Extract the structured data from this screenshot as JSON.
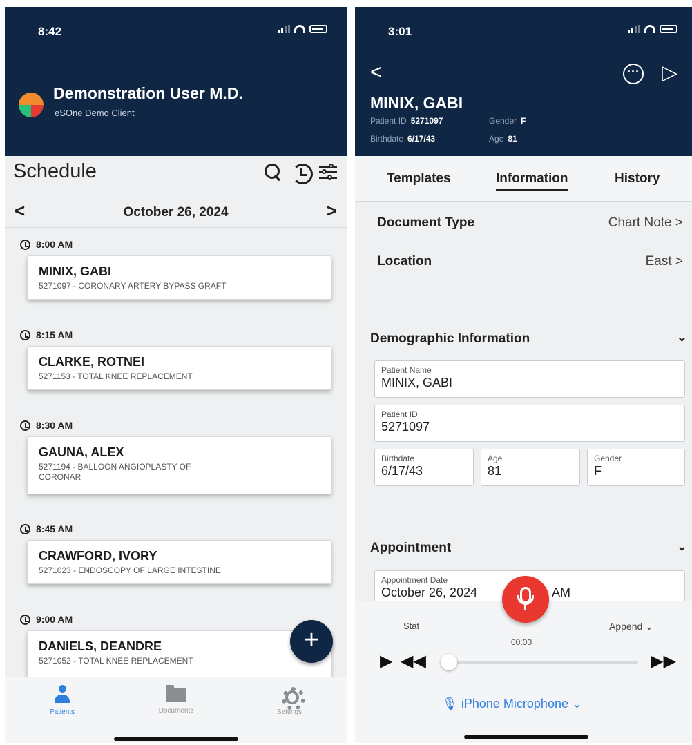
{
  "left": {
    "status_time": "8:42",
    "user_name": "Demonstration User M.D.",
    "client": "eSOne Demo Client",
    "schedule_title": "Schedule",
    "date": "October 26, 2024",
    "appointments": [
      {
        "time": "8:00 AM",
        "name": "MINIX, GABI",
        "proc": "5271097 - CORONARY ARTERY BYPASS GRAFT"
      },
      {
        "time": "8:15 AM",
        "name": "CLARKE, ROTNEI",
        "proc": "5271153 - TOTAL KNEE REPLACEMENT"
      },
      {
        "time": "8:30 AM",
        "name": "GAUNA, ALEX",
        "proc": "5271194 - BALLOON ANGIOPLASTY OF CORONAR"
      },
      {
        "time": "8:45 AM",
        "name": "CRAWFORD, IVORY",
        "proc": "5271023 - ENDOSCOPY OF LARGE INTESTINE"
      },
      {
        "time": "9:00 AM",
        "name": "DANIELS, DEANDRE",
        "proc": "5271052 - TOTAL KNEE REPLACEMENT"
      }
    ],
    "fab_label": "+",
    "tabs": [
      {
        "label": "Patients"
      },
      {
        "label": "Documents"
      },
      {
        "label": "Settings"
      }
    ]
  },
  "right": {
    "status_time": "3:01",
    "patient_name": "MINIX, GABI",
    "meta": {
      "patient_id_label": "Patient ID",
      "patient_id": "5271097",
      "gender_label": "Gender",
      "gender": "F",
      "birthdate_label": "Birthdate",
      "birthdate": "6/17/43",
      "age_label": "Age",
      "age": "81"
    },
    "tabs": [
      "Templates",
      "Information",
      "History"
    ],
    "rows": [
      {
        "label": "Document Type",
        "value": "Chart Note"
      },
      {
        "label": "Location",
        "value": "East"
      }
    ],
    "demographic": {
      "title": "Demographic Information",
      "patient_name_label": "Patient Name",
      "patient_name": "MINIX, GABI",
      "patient_id_label": "Patient ID",
      "patient_id": "5271097",
      "birthdate_label": "Birthdate",
      "birthdate": "6/17/43",
      "age_label": "Age",
      "age": "81",
      "gender_label": "Gender",
      "gender": "F"
    },
    "appointment": {
      "title": "Appointment",
      "date_label": "Appointment Date",
      "date_value": "October 26, 2024",
      "time_suffix": "AM"
    },
    "recorder": {
      "stat": "Stat",
      "append": "Append",
      "timer": "00:00",
      "input": "iPhone Microphone",
      "progress": 0.0
    },
    "colors": {
      "accent": "#0f2745",
      "record": "#e8382f",
      "link": "#2f7fe0"
    }
  }
}
